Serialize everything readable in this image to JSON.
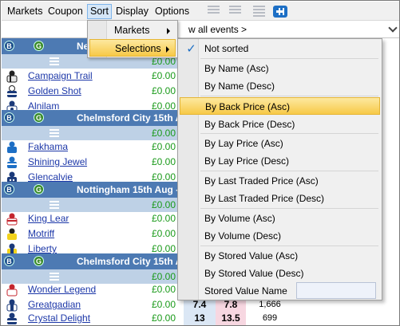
{
  "menubar": {
    "items": [
      "Markets",
      "Coupon",
      "Sort",
      "Display",
      "Options"
    ]
  },
  "events_bar": {
    "text": "w all events >"
  },
  "sections": [
    {
      "title": "Ne",
      "sub_amount": "£0.00",
      "runners": [
        {
          "name": "Campaign Trail",
          "amount": "£0.00"
        },
        {
          "name": "Golden Shot",
          "amount": "£0.00"
        },
        {
          "name": "Alnilam",
          "amount": "£0.00"
        }
      ]
    },
    {
      "title": "Chelmsford City 15th A",
      "sub_amount": "£0.00",
      "runners": [
        {
          "name": "Fakhama",
          "amount": "£0.00"
        },
        {
          "name": "Shining Jewel",
          "amount": "£0.00"
        },
        {
          "name": "Glencalvie",
          "amount": "£0.00"
        }
      ]
    },
    {
      "title": "Nottingham 15th Aug -",
      "sub_amount": "£0.00",
      "runners": [
        {
          "name": "King Lear",
          "amount": "£0.00"
        },
        {
          "name": "Motriff",
          "amount": "£0.00"
        },
        {
          "name": "Liberty",
          "amount": "£0.00"
        }
      ]
    },
    {
      "title": "Chelmsford City 15th A",
      "sub_amount": "£0.00",
      "runners": [
        {
          "name": "Wonder Legend",
          "amount": "£0.00"
        },
        {
          "name": "Greatgadian",
          "amount": "£0.00",
          "back": "7.4",
          "lay": "7.8",
          "vol": "1,666"
        },
        {
          "name": "Crystal Delight",
          "amount": "£0.00",
          "back": "13",
          "lay": "13.5",
          "vol": "699"
        }
      ]
    }
  ],
  "sort_menu": {
    "items": [
      {
        "label": "Markets"
      },
      {
        "label": "Selections"
      }
    ]
  },
  "selections_submenu": {
    "items": [
      {
        "label": "Not sorted"
      },
      {
        "label": "By Name (Asc)"
      },
      {
        "label": "By Name (Desc)"
      },
      {
        "label": "By Back Price (Asc)"
      },
      {
        "label": "By Back Price (Desc)"
      },
      {
        "label": "By Lay Price (Asc)"
      },
      {
        "label": "By Lay Price (Desc)"
      },
      {
        "label": "By Last Traded Price (Asc)"
      },
      {
        "label": "By Last Traded Price (Desc)"
      },
      {
        "label": "By Volume (Asc)"
      },
      {
        "label": "By Volume (Desc)"
      },
      {
        "label": "By Stored Value (Asc)"
      },
      {
        "label": "By Stored Value (Desc)"
      },
      {
        "label": "Stored Value Name"
      }
    ],
    "stored_value_name_input": ""
  },
  "badges": {
    "b": "B",
    "g": "G"
  },
  "colors": {
    "section_header": "#4d7ab3",
    "sub_row": "#bed1e6",
    "menu_highlight": "#f7c948",
    "runner_link": "#1c37a8",
    "amount_green": "#1a9a1a",
    "lay_cell": "#f7d7e1",
    "back_cell": "#dbe7f5"
  }
}
